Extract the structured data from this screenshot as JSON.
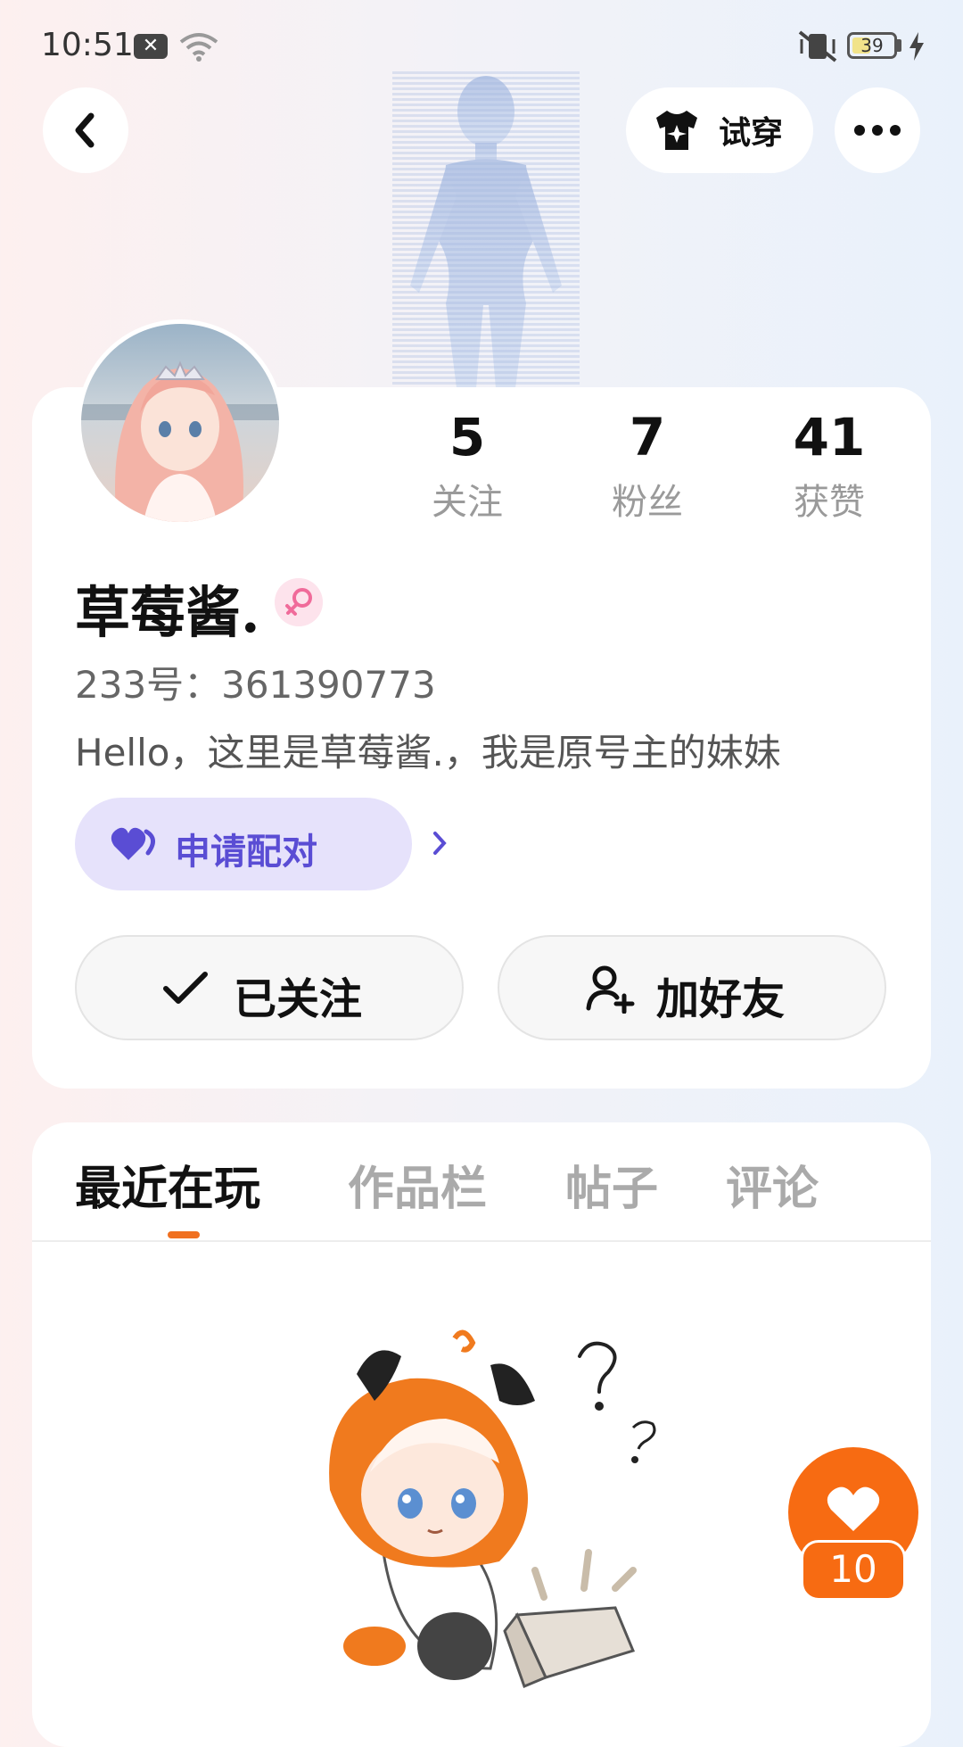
{
  "status_bar": {
    "time": "10:51",
    "battery": "39"
  },
  "header": {
    "tryon_label": "试穿"
  },
  "profile": {
    "stats": [
      {
        "value": "5",
        "label": "关注"
      },
      {
        "value": "7",
        "label": "粉丝"
      },
      {
        "value": "41",
        "label": "获赞"
      }
    ],
    "name": "草莓酱.",
    "uid": "233号：361390773",
    "bio": "Hello，这里是草莓酱.，我是原号主的妹妹",
    "pair_label": "申请配对",
    "followed_label": "已关注",
    "add_friend_label": "加好友"
  },
  "tabs": [
    "最近在玩",
    "作品栏",
    "帖子",
    "评论"
  ],
  "active_tab": "最近在玩",
  "like": {
    "count": "10"
  },
  "colors": {
    "accent": "#f76b12",
    "pair_bg": "#e6e2fb",
    "pair_text": "#5a4dd4"
  }
}
